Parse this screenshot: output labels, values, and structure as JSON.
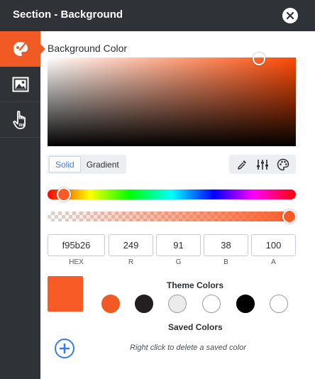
{
  "header": {
    "title": "Section - Background"
  },
  "sidebar": {
    "tabs": [
      {
        "icon": "paint-palette-icon",
        "active": true
      },
      {
        "icon": "image-icon",
        "active": false
      },
      {
        "icon": "hand-pointer-icon",
        "active": false
      }
    ]
  },
  "picker": {
    "label": "Background Color",
    "mode": {
      "solid": "Solid",
      "gradient": "Gradient",
      "selected": "Solid"
    },
    "tools": [
      "eyedropper-icon",
      "sliders-icon",
      "palette-icon"
    ],
    "current_color": "#f95b26",
    "hue_base": "#ff4a05",
    "alpha_level": 1.0
  },
  "fields": {
    "hex": {
      "value": "f95b26",
      "label": "HEX"
    },
    "r": {
      "value": "249",
      "label": "R"
    },
    "g": {
      "value": "91",
      "label": "G"
    },
    "b": {
      "value": "38",
      "label": "B"
    },
    "a": {
      "value": "100",
      "label": "A"
    }
  },
  "theme": {
    "label": "Theme Colors",
    "colors": [
      "#f15a24",
      "#231f20",
      "#ebebeb",
      "#ffffff",
      "#000000",
      "#ffffff"
    ]
  },
  "saved": {
    "label": "Saved Colors",
    "hint": "Right click to delete a saved color"
  },
  "colors": {
    "accent": "#f15a24",
    "dark": "#2f3337",
    "link": "#3b7be8"
  }
}
